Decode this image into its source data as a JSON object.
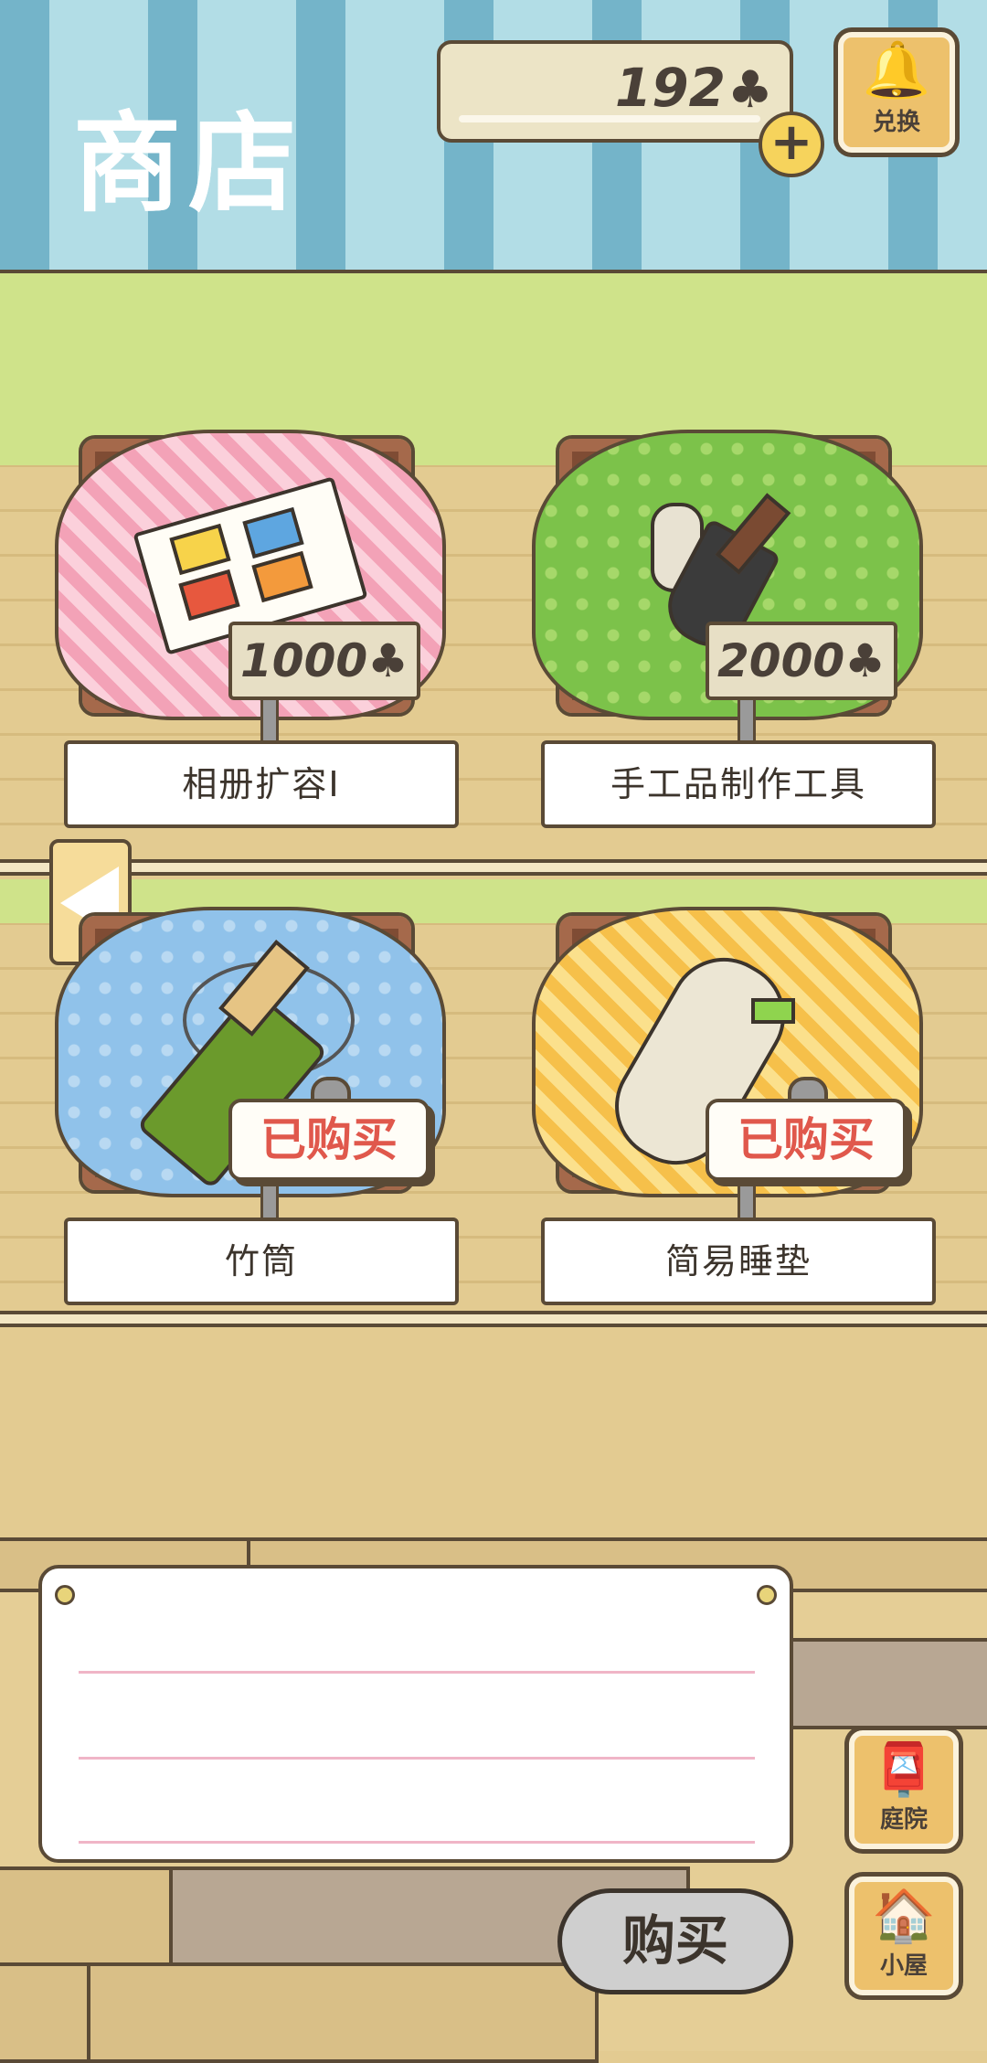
{
  "header": {
    "title": "商店",
    "clover_count": "192",
    "clover_symbol": "♣",
    "add_symbol": "+",
    "exchange_label": "兑换"
  },
  "items": [
    {
      "name": "相册扩容Ⅰ",
      "status": "price",
      "price": "1000♣",
      "cloth": "pink",
      "icon": "photo-album-icon"
    },
    {
      "name": "手工品制作工具",
      "status": "price",
      "price": "2000♣",
      "cloth": "green",
      "icon": "craft-tools-icon"
    },
    {
      "name": "竹筒",
      "status": "sold",
      "sold_label": "已购买",
      "cloth": "blue",
      "icon": "bamboo-canteen-icon"
    },
    {
      "name": "简易睡垫",
      "status": "sold",
      "sold_label": "已购买",
      "cloth": "yellow",
      "icon": "sleeping-mat-icon"
    }
  ],
  "footer": {
    "buy_label": "购买",
    "garden_label": "庭院",
    "house_label": "小屋"
  },
  "colors": {
    "awning_blue": "#74b4c9",
    "awning_light": "#b2dde6",
    "shelf_green": "#cfe38a",
    "wood": "#e3cb91",
    "sold_red": "#e0584c"
  }
}
